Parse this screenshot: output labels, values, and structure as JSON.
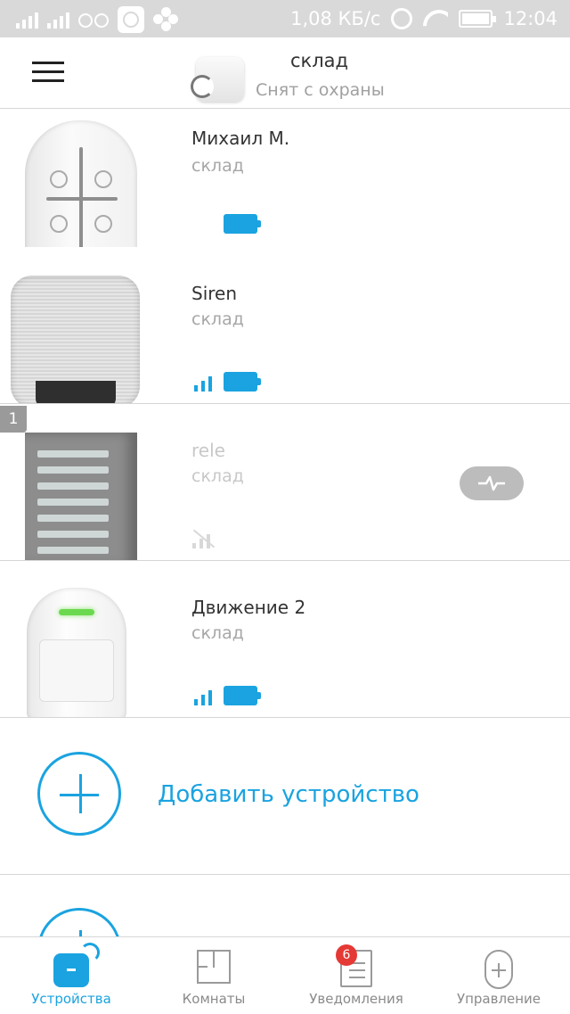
{
  "status_bar": {
    "speed": "1,08 КБ/с",
    "time": "12:04"
  },
  "header": {
    "hub_name": "склад",
    "hub_status": "Снят с охраны"
  },
  "devices": [
    {
      "name": "Михаил М.",
      "room": "склад",
      "battery": "full",
      "signal": null
    },
    {
      "name": "Siren",
      "room": "склад",
      "battery": "full",
      "signal": "3 of 3"
    },
    {
      "name": "rele",
      "room": "склад",
      "battery": null,
      "signal": "none",
      "slot_badge": "1",
      "state": "offline"
    },
    {
      "name": "Движение 2",
      "room": "склад",
      "battery": "full",
      "signal": "3 of 3"
    }
  ],
  "add_device": {
    "label": "Добавить устройство"
  },
  "bottom_nav": [
    {
      "label": "Устройства",
      "active": true,
      "icon": "devices-icon"
    },
    {
      "label": "Комнаты",
      "active": false,
      "icon": "rooms-icon"
    },
    {
      "label": "Уведомления",
      "active": false,
      "icon": "notifications-icon",
      "badge": "6"
    },
    {
      "label": "Управление",
      "active": false,
      "icon": "control-icon"
    }
  ],
  "colors": {
    "accent": "#1aa3e0",
    "badge": "#e53935"
  }
}
